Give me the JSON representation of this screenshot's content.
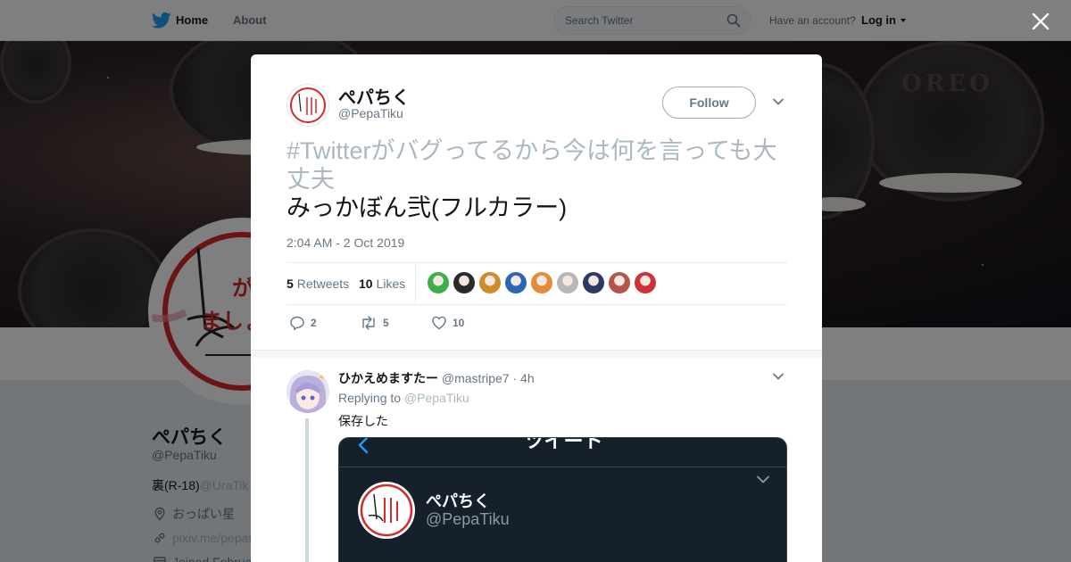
{
  "topnav": {
    "home_label": "Home",
    "about_label": "About",
    "search_placeholder": "Search Twitter",
    "account_prompt": "Have an account?",
    "login_label": "Log in"
  },
  "banner": {
    "cookie_text": "OREO"
  },
  "profile": {
    "name": "ぺパちく",
    "handle": "@PepaTiku",
    "bio_prefix": "裏(R-18)",
    "bio_link": "@UraTik",
    "location": "おっぱい星",
    "url": "pixiv.me/pepat",
    "joined": "Joined Februar",
    "avatar_text_1": "がんばり",
    "avatar_text_2": "ましょう"
  },
  "modal": {
    "author_name": "ぺパちく",
    "author_handle": "@PepaTiku",
    "follow_label": "Follow",
    "hashtag_text": "#Twitterがバグってるから今は何を言っても大丈夫",
    "body_text": "みっかぼん弐(フルカラー)",
    "timestamp": "2:04 AM - 2 Oct 2019",
    "retweets_count": "5",
    "retweets_label": "Retweets",
    "likes_count": "10",
    "likes_label": "Likes",
    "liker_colors": [
      "#3fae49",
      "#2b2b2b",
      "#d08a2a",
      "#2a67b5",
      "#e58a3a",
      "#b8b8b8",
      "#2d3a66",
      "#b4554a",
      "#d0303a"
    ],
    "actions": {
      "reply_count": "2",
      "retweet_count": "5",
      "like_count": "10"
    }
  },
  "reply": {
    "name": "ひかえめますたー",
    "handle": "@mastripe7",
    "separator": "·",
    "time": "4h",
    "replying_prefix": "Replying to",
    "replying_handle": "@PepaTiku",
    "text": "保存した",
    "embed": {
      "title": "ツイート",
      "name": "ぺパちく",
      "handle": "@PepaTiku"
    }
  },
  "colors": {
    "twitter_blue": "#1da1f2",
    "text_primary": "#14171a",
    "text_secondary": "#657786"
  }
}
